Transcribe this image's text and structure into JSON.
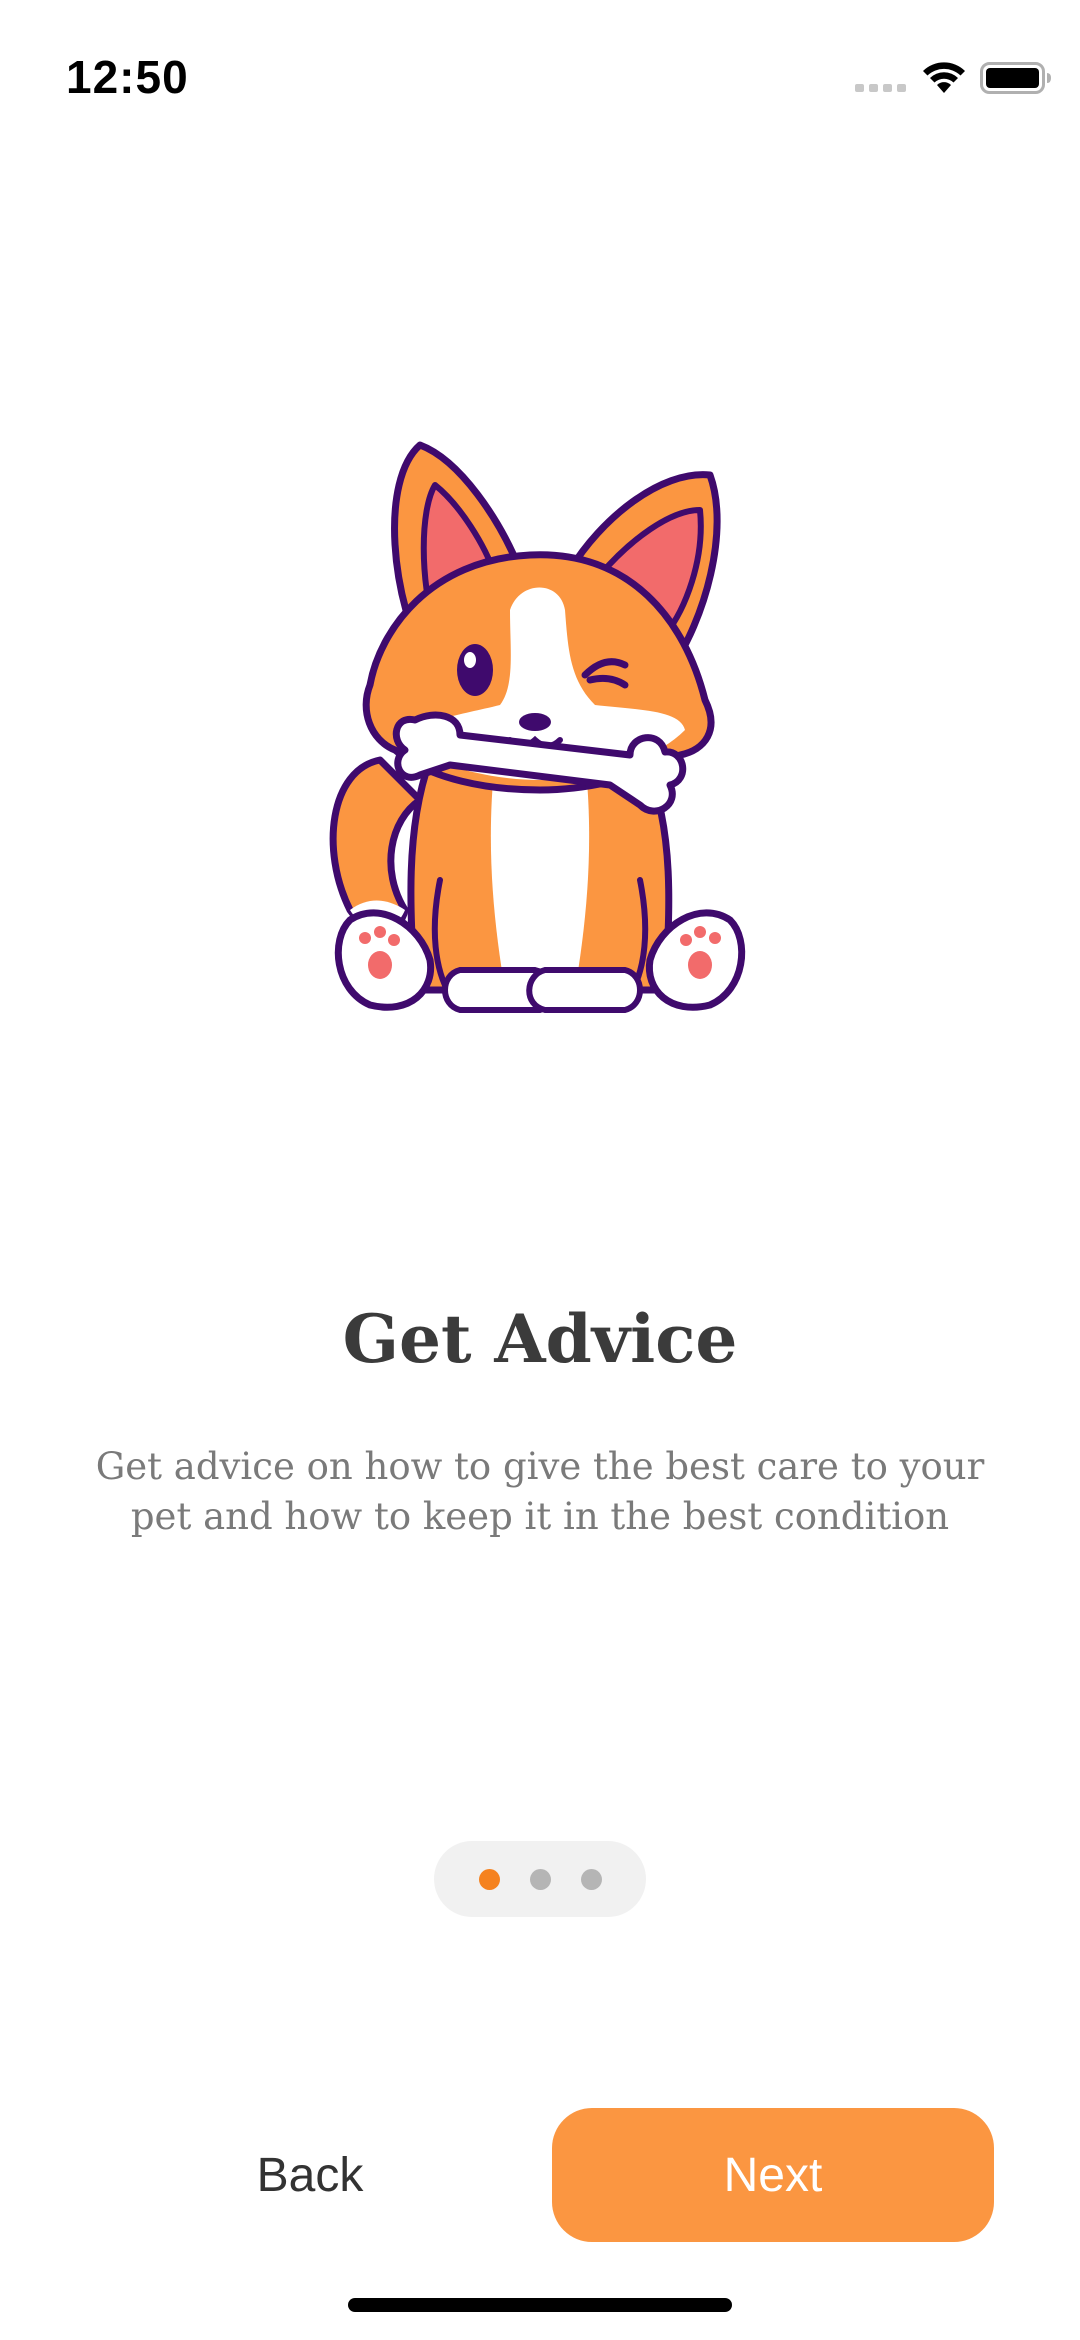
{
  "status_bar": {
    "time": "12:50"
  },
  "illustration": {
    "icon": "corgi-with-bone-icon"
  },
  "onboarding": {
    "title": "Get Advice",
    "description": "Get advice on how to give the best care to your pet and how to keep it in the best condition"
  },
  "pager": {
    "total_pages": 3,
    "current_page": 1
  },
  "buttons": {
    "back_label": "Back",
    "next_label": "Next"
  },
  "colors": {
    "accent": "#fb9641",
    "active_dot": "#f5821f",
    "inactive_dot": "#b5b5b5",
    "title": "#3b3b3b",
    "description": "#7a7a7a"
  }
}
